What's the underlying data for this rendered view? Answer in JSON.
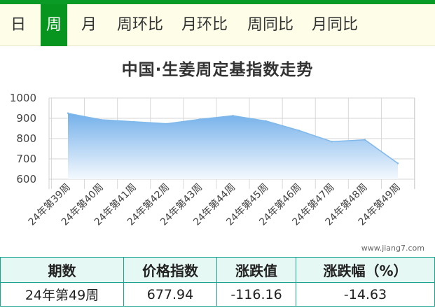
{
  "tabs": [
    {
      "label": "日",
      "active": false
    },
    {
      "label": "周",
      "active": true
    },
    {
      "label": "月",
      "active": false
    },
    {
      "label": "周环比",
      "active": false
    },
    {
      "label": "月环比",
      "active": false
    },
    {
      "label": "周同比",
      "active": false
    },
    {
      "label": "月同比",
      "active": false
    }
  ],
  "chart_data": {
    "type": "area",
    "title": "中国·生姜周定基指数走势",
    "categories": [
      "24年第39周",
      "24年第40周",
      "24年第41周",
      "24年第42周",
      "24年第43周",
      "24年第44周",
      "24年第45周",
      "24年第46周",
      "24年第47周",
      "24年第48周",
      "24年第49周"
    ],
    "values": [
      925,
      893,
      883,
      873,
      895,
      913,
      887,
      840,
      785,
      794,
      677.94
    ],
    "ylim": [
      600,
      1000
    ],
    "yticks": [
      600,
      700,
      800,
      900,
      1000
    ],
    "grid": true,
    "colors": {
      "line": "#7fb8ea",
      "fill_top": "#74b0ea",
      "fill_bottom": "#f4f9fe"
    },
    "watermark": "www.jiang7.com"
  },
  "table": {
    "headers": [
      "期数",
      "价格指数",
      "涨跌值",
      "涨跌幅（%）"
    ],
    "rows": [
      [
        "24年第49周",
        "677.94",
        "-116.16",
        "-14.63"
      ]
    ]
  }
}
